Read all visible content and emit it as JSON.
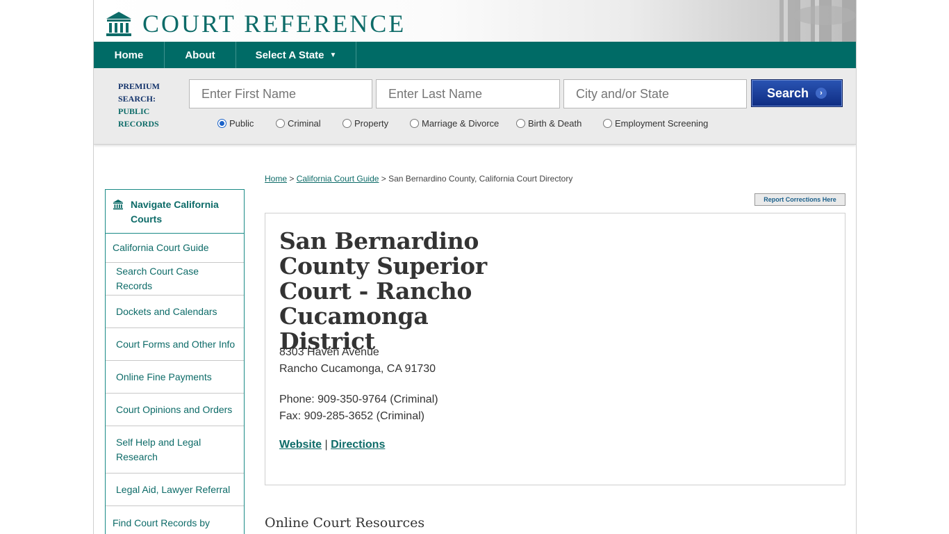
{
  "brand": {
    "name": "COURT REFERENCE"
  },
  "nav": {
    "home": "Home",
    "about": "About",
    "select_state": "Select A State",
    "caret": "▼"
  },
  "search": {
    "premium_line1": "PREMIUM",
    "premium_line2": "SEARCH:",
    "premium_line3": "PUBLIC",
    "premium_line4": "RECORDS",
    "first_placeholder": "Enter First Name",
    "last_placeholder": "Enter Last Name",
    "city_placeholder": "City and/or State",
    "button_label": "Search",
    "button_arrow": "›",
    "options": [
      "Public",
      "Criminal",
      "Property",
      "Marriage & Divorce",
      "Birth & Death",
      "Employment Screening"
    ],
    "selected": "Public"
  },
  "breadcrumb": {
    "home": "Home",
    "sep1": " > ",
    "guide": "California Court Guide",
    "sep2": " > ",
    "current": "San Bernardino County, California Court Directory"
  },
  "report_button": "Report Corrections Here",
  "sidebar": {
    "title": "Navigate California Courts",
    "items": [
      "California Court Guide",
      "Search Court Case Records",
      "Dockets and Calendars",
      "Court Forms and Other Info",
      "Online Fine Payments",
      "Court Opinions and Orders",
      "Self Help and Legal Research",
      "Legal Aid, Lawyer Referral",
      "Find Court Records by California County"
    ]
  },
  "court": {
    "name": "San Bernardino County Superior Court - Rancho Cucamonga District",
    "address_line1": "8303 Haven Avenue",
    "address_line2": "Rancho Cucamonga, CA 91730",
    "phone": "Phone: 909-350-9764 (Criminal)",
    "fax": "Fax: 909-285-3652 (Criminal)",
    "website_label": "Website",
    "separator": " | ",
    "directions_label": "Directions"
  },
  "section_title": "Online Court Resources",
  "colors": {
    "brand_teal": "#006b66",
    "search_blue": "#0e2c82"
  }
}
